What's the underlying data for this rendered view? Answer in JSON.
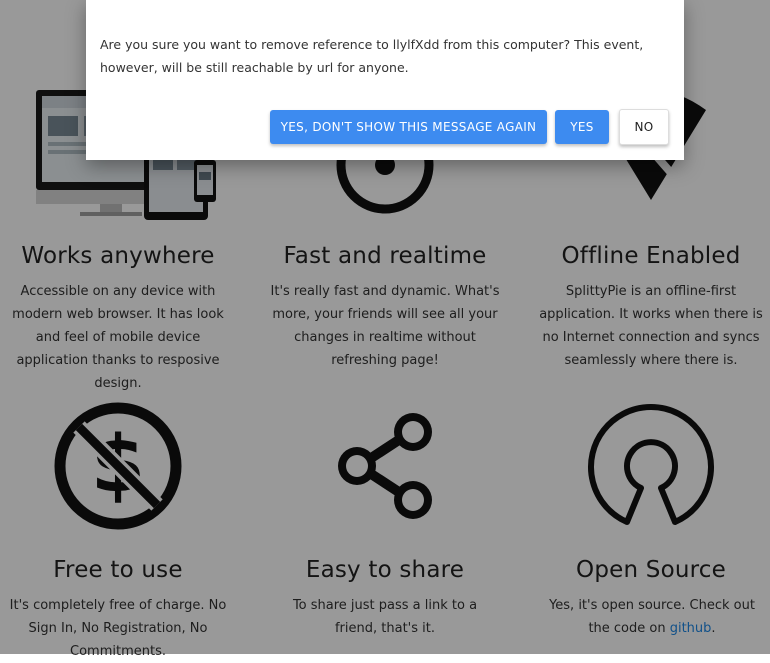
{
  "features": [
    {
      "title": "Works anywhere",
      "desc": "Accessible on any device with modern web browser. It has look and feel of mobile device application thanks to resposive design.",
      "icon": "devices-icon"
    },
    {
      "title": "Fast and realtime",
      "desc": "It's really fast and dynamic. What's more, your friends will see all your changes in realtime without refreshing page!",
      "icon": "realtime-icon"
    },
    {
      "title": "Offline Enabled",
      "desc": "SplittyPie is an offline-first application. It works when there is no Internet connection and syncs seamlessly where there is.",
      "icon": "wifi-off-icon"
    },
    {
      "title": "Free to use",
      "desc": "It's completely free of charge. No Sign In, No Registration, No Commitments.",
      "icon": "no-money-icon"
    },
    {
      "title": "Easy to share",
      "desc": "To share just pass a link to a friend, that's it.",
      "icon": "share-icon"
    },
    {
      "title": "Open Source",
      "desc_prefix": "Yes, it's open source. Check out the code on ",
      "link": "github",
      "desc_suffix": ".",
      "icon": "open-source-icon"
    }
  ],
  "dialog": {
    "message": "Are you sure you want to remove reference to llylfXdd from this computer? This event, however, will be still reachable by url for anyone.",
    "btn_dont_show": "YES, DON'T SHOW THIS MESSAGE AGAIN",
    "btn_yes": "YES",
    "btn_no": "NO"
  },
  "colors": {
    "primary": "#3d8bf0",
    "link": "#1e88e5",
    "overlay": "rgba(0,0,0,0.4)"
  }
}
